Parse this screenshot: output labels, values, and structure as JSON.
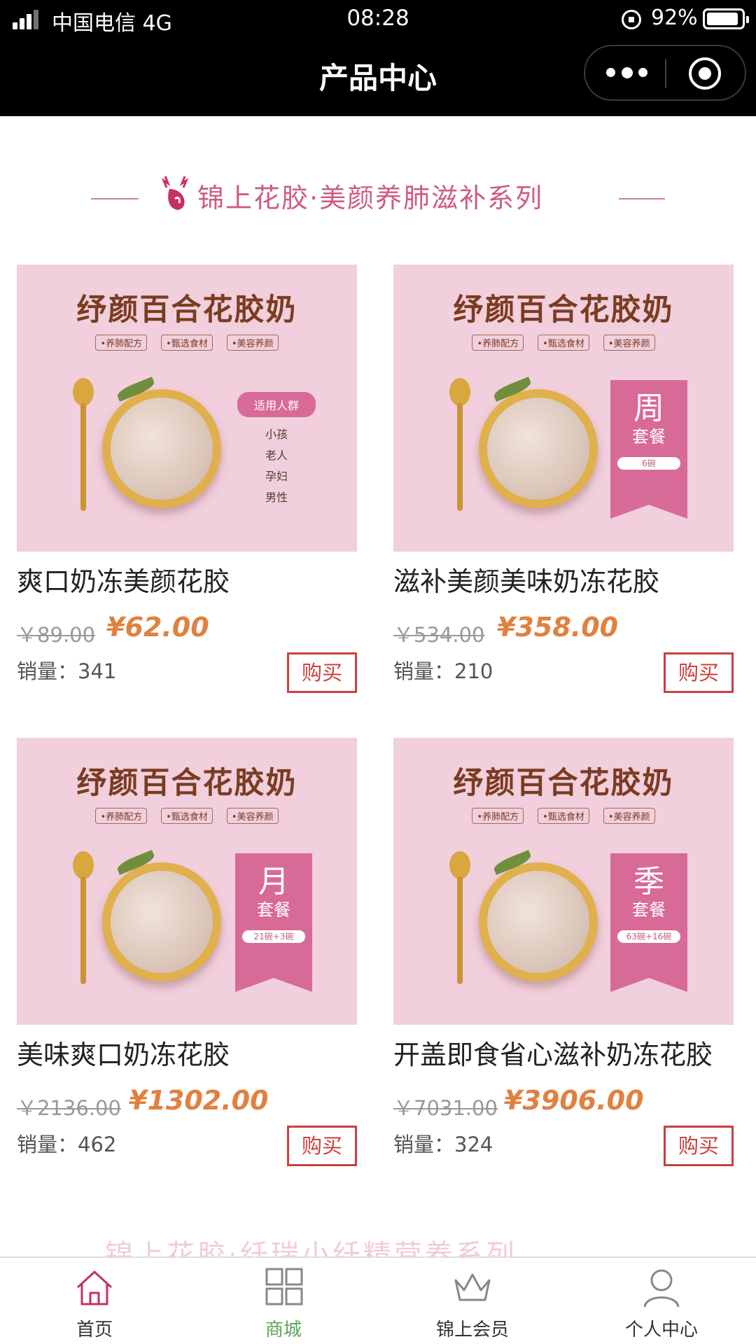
{
  "status_bar": {
    "carrier": "中国电信  4G",
    "time": "08:28",
    "battery": "92%",
    "battery_level": 0.92
  },
  "nav": {
    "title": "产品中心"
  },
  "section": {
    "title": "锦上花胶·美颜养肺滋补系列",
    "next_title": "锦上花胶·纤瑞小纤精营养系列"
  },
  "banner": {
    "heading": "纾颜百合花胶奶",
    "tags": [
      "•养肺配方",
      "•甄选食材",
      "•美容养颜"
    ],
    "audience_title": "适用人群",
    "audience": [
      "小孩",
      "老人",
      "孕妇",
      "男性"
    ]
  },
  "products": [
    {
      "name": "爽口奶冻美颜花胶",
      "old_price": "￥89.00",
      "price": "¥62.00",
      "sales": "销量：341",
      "buy": "购买",
      "package": null
    },
    {
      "name": "滋补美颜美味奶冻花胶",
      "old_price": "￥534.00",
      "price": "¥358.00",
      "sales": "销量：210",
      "buy": "购买",
      "package": {
        "period": "周",
        "label": "套餐",
        "qty": "6碗"
      }
    },
    {
      "name": "美味爽口奶冻花胶",
      "old_price": "￥2136.00",
      "price": "¥1302.00",
      "sales": "销量：462",
      "buy": "购买",
      "package": {
        "period": "月",
        "label": "套餐",
        "qty": "21碗+3碗"
      }
    },
    {
      "name": "开盖即食省心滋补奶冻花胶",
      "old_price": "￥7031.00",
      "price": "¥3906.00",
      "sales": "销量：324",
      "buy": "购买",
      "package": {
        "period": "季",
        "label": "套餐",
        "qty": "63碗+16碗"
      }
    }
  ],
  "tabbar": [
    {
      "label": "首页",
      "icon": "home-icon",
      "active": false
    },
    {
      "label": "商城",
      "icon": "grid-icon",
      "active": true
    },
    {
      "label": "锦上会员",
      "icon": "crown-icon",
      "active": false
    },
    {
      "label": "个人中心",
      "icon": "user-icon",
      "active": false
    }
  ],
  "colors": {
    "accent_pink": "#cf5a86",
    "price_orange": "#e0813f",
    "buy_red": "#c9403e",
    "tab_active": "#5aa55a"
  }
}
